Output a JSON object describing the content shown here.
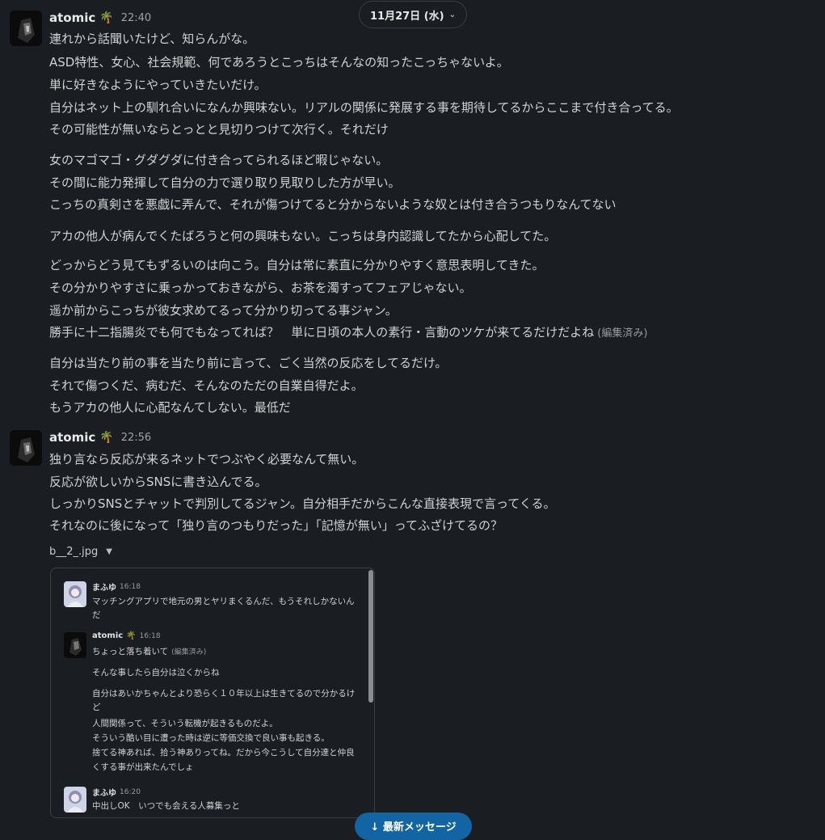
{
  "header": {
    "date_label": "11月27日 (水)"
  },
  "messages": [
    {
      "user": "atomic",
      "status_emoji": "🌴",
      "time": "22:40",
      "lines": [
        "連れから話聞いたけど、知らんがな。",
        "ASD特性、女心、社会規範、何であろうとこっちはそんなの知ったこっちゃないよ。",
        "単に好きなようにやっていきたいだけ。",
        "自分はネット上の馴れ合いになんか興味ない。リアルの関係に発展する事を期待してるからここまで付き合ってる。",
        "その可能性が無いならとっとと見切りつけて次行く。それだけ",
        "女のマゴマゴ・グダグダに付き合ってられるほど暇じゃない。",
        "その間に能力発揮して自分の力で選り取り見取りした方が早い。",
        "こっちの真剣さを悪戯に弄んで、それが傷つけてると分からないような奴とは付き合うつもりなんてない",
        "アカの他人が病んでくたばろうと何の興味もない。こっちは身内認識してたから心配してた。",
        "どっからどう見てもずるいのは向こう。自分は常に素直に分かりやすく意思表明してきた。",
        "その分かりやすさに乗っかっておきながら、お茶を濁すってフェアじゃない。",
        "遥か前からこっちが彼女求めてるって分かり切ってる事ジャン。",
        "勝手に十二指腸炎でも何でもなってれば？　単に日頃の本人の素行・言動のツケが来てるだけだよね",
        "自分は当たり前の事を当たり前に言って、ごく当然の反応をしてるだけ。",
        "それで傷つくだ、病むだ、そんなのただの自業自得だよ。",
        "もうアカの他人に心配なんてしない。最低だ"
      ],
      "edited_label": "(編集済み)"
    },
    {
      "user": "atomic",
      "status_emoji": "🌴",
      "time": "22:56",
      "lines": [
        "独り言なら反応が来るネットでつぶやく必要なんて無い。",
        "反応が欲しいからSNSに書き込んでる。",
        "しっかりSNSとチャットで判別してるジャン。自分相手だからこんな直接表現で言ってくる。",
        "それなのに後になって「独り言のつもりだった」「記憶が無い」ってふざけてるの？"
      ],
      "attachment": {
        "filename": "b__2_.jpg",
        "embed": {
          "messages": [
            {
              "user": "まふゆ",
              "time": "16:18",
              "lines": [
                "マッチングアプリで地元の男とヤリまくるんだ、もうそれしかないん",
                "だ"
              ]
            },
            {
              "user": "atomic",
              "status_emoji": "🌴",
              "time": "16:18",
              "edited_label": "(編集済み)",
              "lines": [
                "ちょっと落ち着いて",
                "そんな事したら自分は泣くからね",
                "自分はあいかちゃんとより恐らく１０年以上は生きてるので分かるけ",
                "ど",
                "人間関係って、そういう転機が起きるものだよ。",
                "そういう酷い目に遭った時は逆に等価交換で良い事も起きる。",
                "捨てる神あれば、拾う神ありってね。だから今こうして自分達と仲良",
                "くする事が出来たんでしょ"
              ]
            },
            {
              "user": "まふゆ",
              "time": "16:20",
              "lines": [
                "中出しOK　いつでも会える人募集っと"
              ]
            }
          ]
        }
      }
    }
  ],
  "footer": {
    "new_messages_button": "↓ 最新メッセージ"
  }
}
